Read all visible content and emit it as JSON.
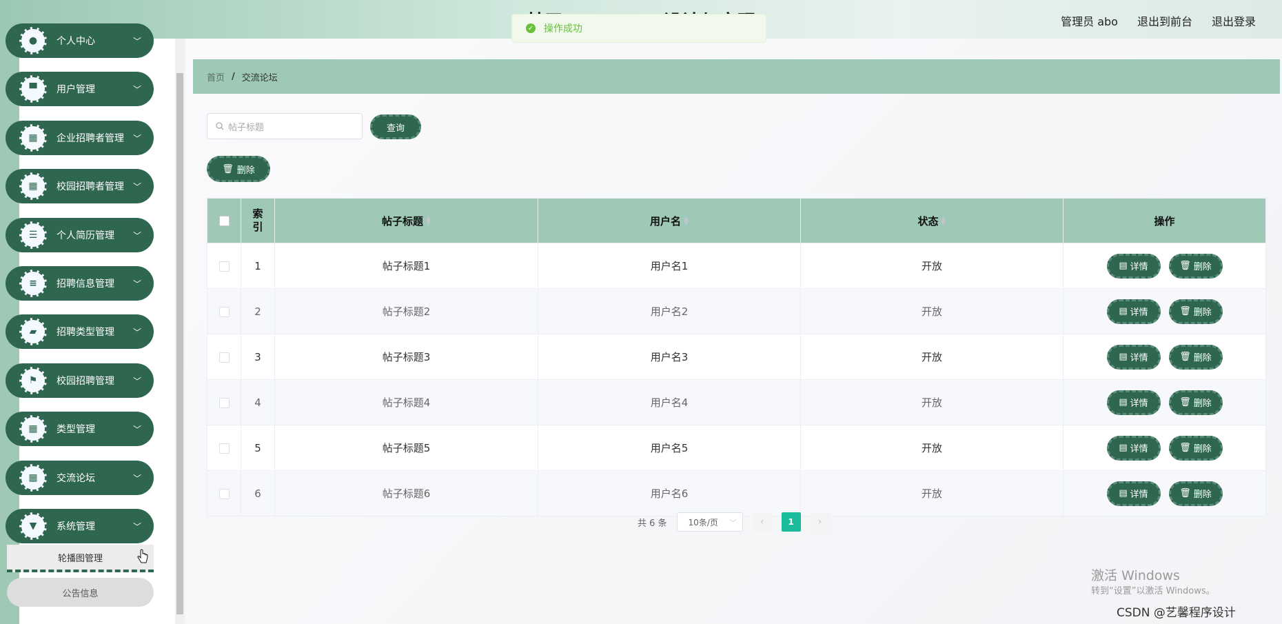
{
  "header": {
    "title": "基于spring       ·          ·       设计与实现",
    "user": "管理员 abo",
    "to_front": "退出到前台",
    "logout": "退出登录"
  },
  "toast": {
    "message": "操作成功"
  },
  "sidebar": {
    "items": [
      {
        "label": "个人中心",
        "icon": "person-icon"
      },
      {
        "label": "用户管理",
        "icon": "monitor-icon"
      },
      {
        "label": "企业招聘者管理",
        "icon": "grid-icon"
      },
      {
        "label": "校园招聘者管理",
        "icon": "grid-icon"
      },
      {
        "label": "个人简历管理",
        "icon": "list-icon"
      },
      {
        "label": "招聘信息管理",
        "icon": "sliders-icon"
      },
      {
        "label": "招聘类型管理",
        "icon": "briefcase-icon"
      },
      {
        "label": "校园招聘管理",
        "icon": "flag-icon"
      },
      {
        "label": "类型管理",
        "icon": "grid-icon"
      },
      {
        "label": "交流论坛",
        "icon": "grid-icon"
      },
      {
        "label": "系统管理",
        "icon": "podium-icon"
      }
    ],
    "sub_items": [
      {
        "label": "轮播图管理"
      },
      {
        "label": "公告信息"
      }
    ]
  },
  "breadcrumb": {
    "home": "首页",
    "separator": "/",
    "current": "交流论坛"
  },
  "search": {
    "placeholder": "帖子标题",
    "button": "查询"
  },
  "toolbar": {
    "delete_label": "删除"
  },
  "table": {
    "headers": {
      "index": "索\n引",
      "title": "帖子标题",
      "user": "用户名",
      "status": "状态",
      "action": "操作"
    },
    "rows": [
      {
        "index": "1",
        "title": "帖子标题1",
        "user": "用户名1",
        "status": "开放"
      },
      {
        "index": "2",
        "title": "帖子标题2",
        "user": "用户名2",
        "status": "开放"
      },
      {
        "index": "3",
        "title": "帖子标题3",
        "user": "用户名3",
        "status": "开放"
      },
      {
        "index": "4",
        "title": "帖子标题4",
        "user": "用户名4",
        "status": "开放"
      },
      {
        "index": "5",
        "title": "帖子标题5",
        "user": "用户名5",
        "status": "开放"
      },
      {
        "index": "6",
        "title": "帖子标题6",
        "user": "用户名6",
        "status": "开放"
      }
    ],
    "detail_label": "详情",
    "delete_label": "删除"
  },
  "pagination": {
    "total": "共 6 条",
    "page_size": "10条/页",
    "current_page": "1"
  },
  "watermark": {
    "line1": "激活 Windows",
    "line2": "转到“设置”以激活 Windows。"
  },
  "csdn": "CSDN @艺馨程序设计",
  "colors": {
    "primary": "#2e6650",
    "header_green": "#9dc9b6",
    "active_page": "#1abc9c"
  }
}
